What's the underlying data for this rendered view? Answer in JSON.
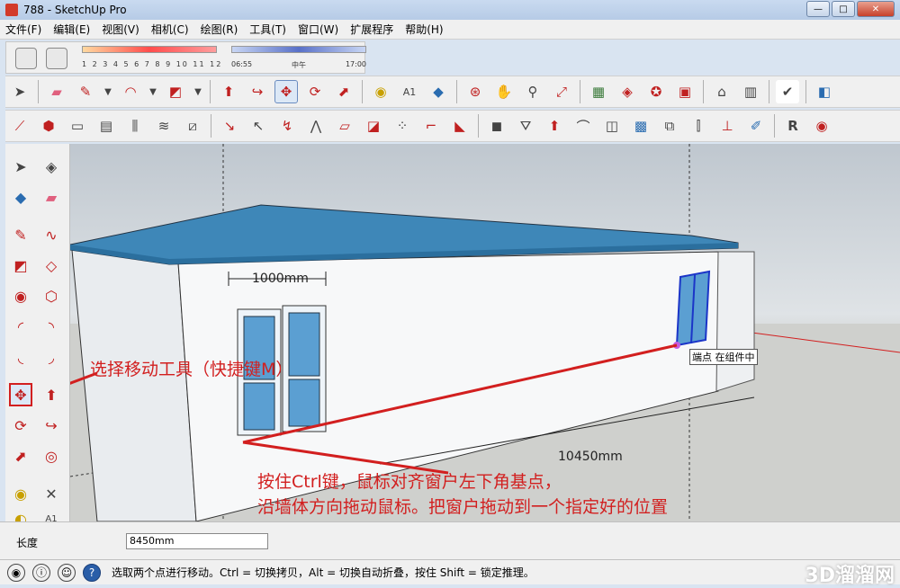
{
  "window": {
    "title": "788 - SketchUp Pro"
  },
  "menu": [
    "文件(F)",
    "编辑(E)",
    "视图(V)",
    "相机(C)",
    "绘图(R)",
    "工具(T)",
    "窗口(W)",
    "扩展程序",
    "帮助(H)"
  ],
  "shadow": {
    "months": "1 2 3 4 5 6 7 8 9 10 11 12",
    "time_start": "06:55",
    "time_mid": "中午",
    "time_end": "17:00"
  },
  "viewport": {
    "dimension_top": "1000mm",
    "dimension_bottom": "10450mm",
    "tooltip": "端点 在组件中"
  },
  "annotations": {
    "select_move": "选择移动工具（快捷键M）",
    "instruction_line1": "按住Ctrl键，鼠标对齐窗户左下角基点，",
    "instruction_line2": "沿墙体方向拖动鼠标。把窗户拖动到一个指定好的位置"
  },
  "measurements": {
    "label": "长度",
    "value": "8450mm"
  },
  "status": {
    "text": "选取两个点进行移动。Ctrl = 切换拷贝，Alt = 切换自动折叠，按住 Shift = 锁定推理。"
  },
  "watermark": "3D溜溜网"
}
